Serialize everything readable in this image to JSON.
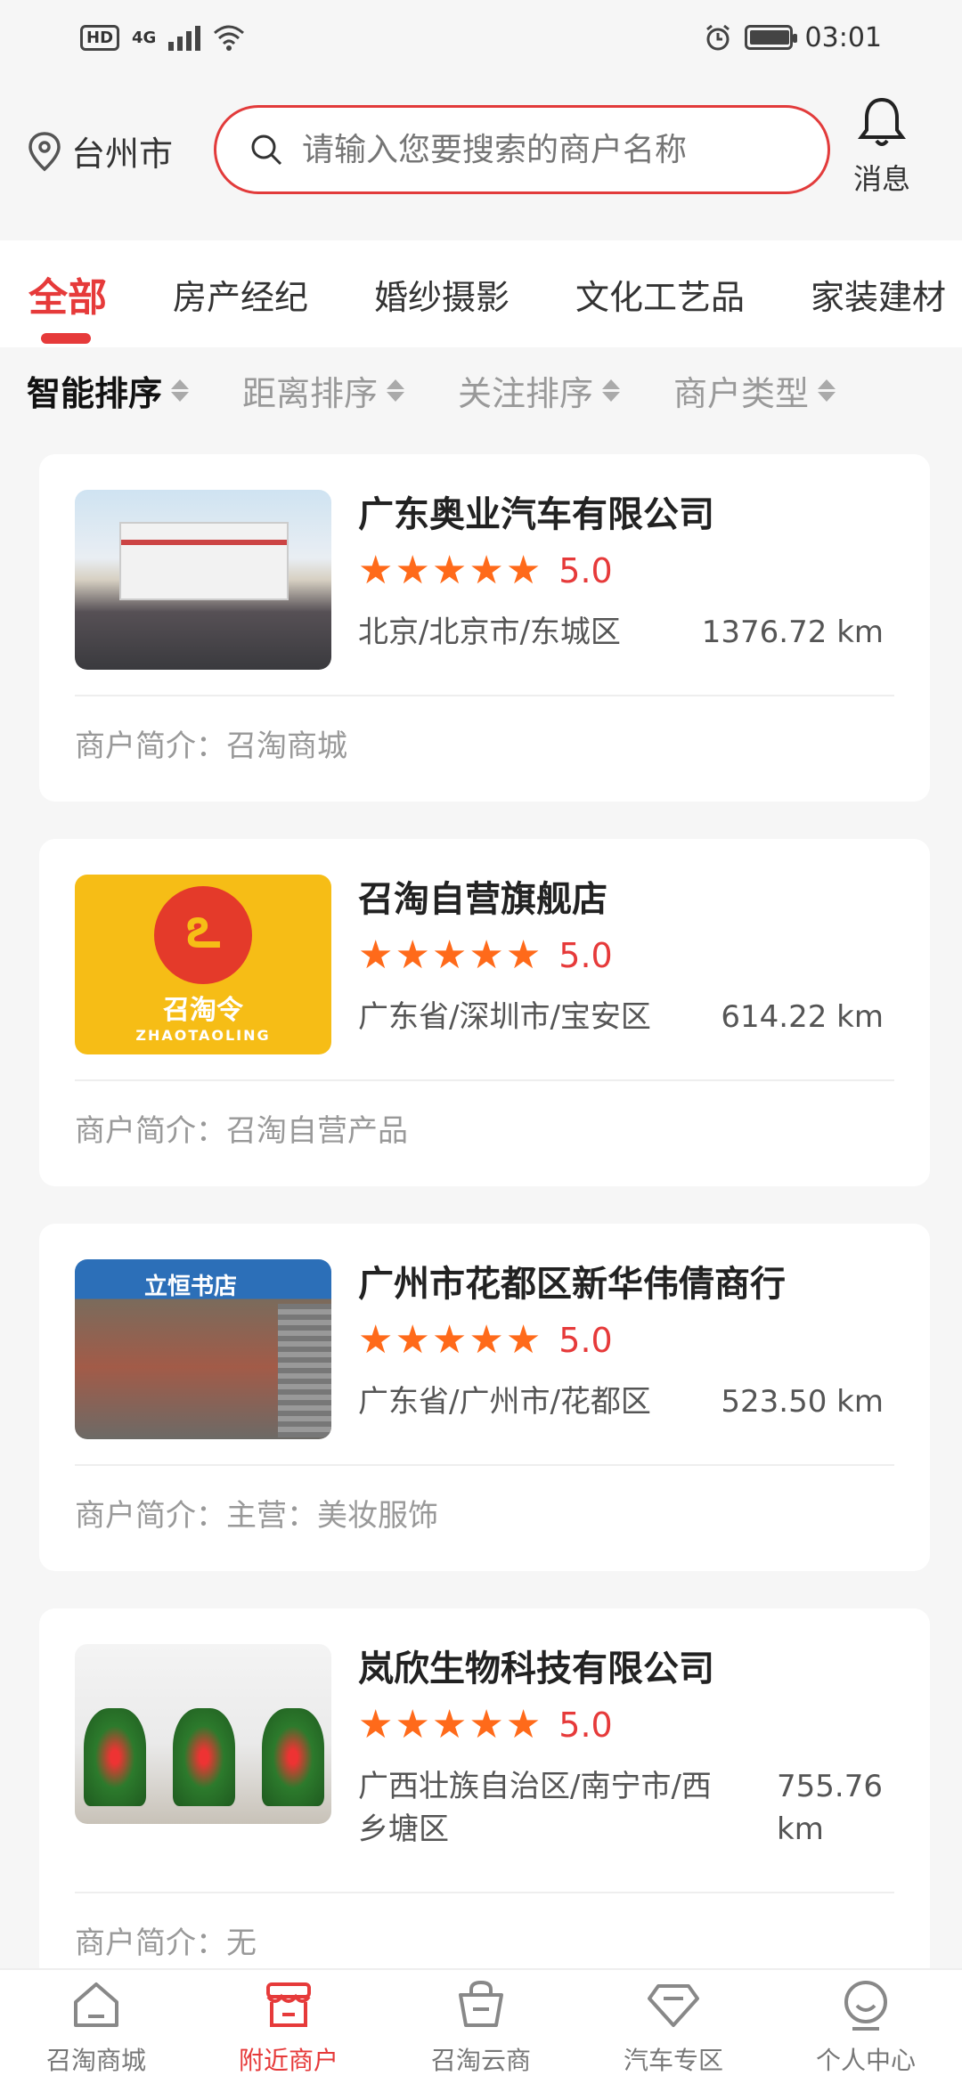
{
  "status_bar": {
    "hd": "HD",
    "network": "4G",
    "time": "03:01"
  },
  "header": {
    "city": "台州市",
    "search_placeholder": "请输入您要搜索的商户名称",
    "message_label": "消息"
  },
  "category_tabs": [
    {
      "label": "全部",
      "active": true
    },
    {
      "label": "房产经纪",
      "active": false
    },
    {
      "label": "婚纱摄影",
      "active": false
    },
    {
      "label": "文化工艺品",
      "active": false
    },
    {
      "label": "家装建材",
      "active": false
    }
  ],
  "sort_options": [
    {
      "label": "智能排序",
      "active": true
    },
    {
      "label": "距离排序",
      "active": false
    },
    {
      "label": "关注排序",
      "active": false
    },
    {
      "label": "商户类型",
      "active": false
    }
  ],
  "merchants": [
    {
      "name": "广东奥业汽车有限公司",
      "rating": "5.0",
      "address": "北京/北京市/东城区",
      "distance": "1376.72 km",
      "brief": "商户简介：召淘商城"
    },
    {
      "name": "召淘自营旗舰店",
      "rating": "5.0",
      "address": "广东省/深圳市/宝安区",
      "distance": "614.22 km",
      "brief": "商户简介：召淘自营产品",
      "logo_text": "召淘令",
      "logo_sub": "ZHAOTAOLING"
    },
    {
      "name": "广州市花都区新华伟倩商行",
      "rating": "5.0",
      "address": "广东省/广州市/花都区",
      "distance": "523.50 km",
      "brief": "商户简介：主营：美妆服饰",
      "shop_sign": "立恒书店"
    },
    {
      "name": "岚欣生物科技有限公司",
      "rating": "5.0",
      "address": "广西壮族自治区/南宁市/西乡塘区",
      "distance": "755.76 km",
      "brief": "商户简介：无"
    }
  ],
  "bottom_nav": [
    {
      "label": "召淘商城",
      "icon": "home-icon",
      "active": false
    },
    {
      "label": "附近商户",
      "icon": "shop-icon",
      "active": true
    },
    {
      "label": "召淘云商",
      "icon": "basket-icon",
      "active": false
    },
    {
      "label": "汽车专区",
      "icon": "diamond-icon",
      "active": false
    },
    {
      "label": "个人中心",
      "icon": "user-icon",
      "active": false
    }
  ],
  "colors": {
    "accent": "#e63a3a",
    "star": "#ff6a1a",
    "background": "#f6f6f6"
  }
}
